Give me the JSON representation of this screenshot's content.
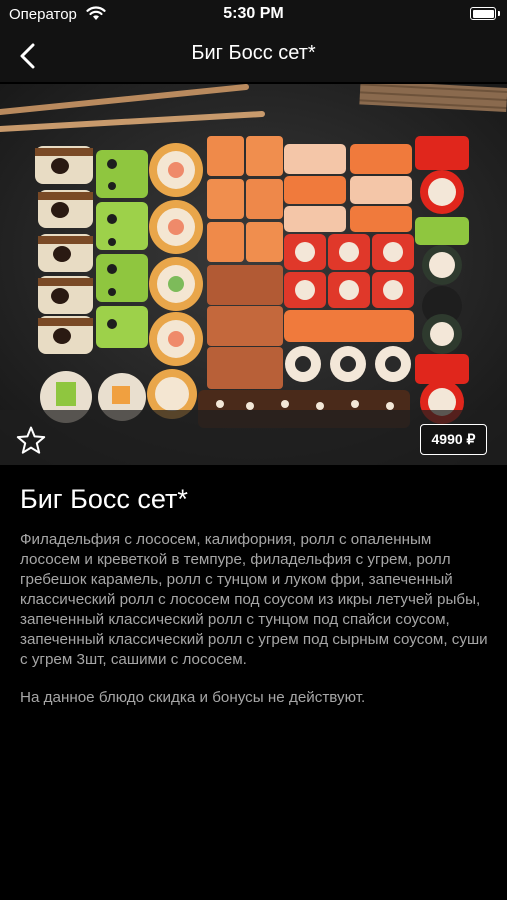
{
  "status_bar": {
    "carrier": "Оператор",
    "time": "5:30 PM"
  },
  "nav": {
    "title": "Биг Босс сет*",
    "back_icon": "chevron-left-icon"
  },
  "product": {
    "title": "Биг Босс сет*",
    "price": "4990 ₽",
    "description": "Филадельфия с лососем, калифорния, ролл с опаленным лососем и креветкой в темпуре, филадельфия с угрем, ролл гребешок карамель, ролл с тунцом и луком фри, запеченный классический ролл с лососем под соусом из икры летучей рыбы, запеченный классический ролл с тунцом под спайси соусом, запеченный классический ролл с угрем под сырным соусом, суши с угрем 3шт, сашими с лососем.",
    "note": "На данное блюдо скидка и бонусы не действуют.",
    "favorite_icon": "star-outline-icon"
  },
  "colors": {
    "background": "#000000",
    "bar": "#121212",
    "text_secondary": "#a6a6a6",
    "salmon": "#f0783c",
    "tobiko": "#e0261c",
    "cucumber": "#8fc63f"
  }
}
